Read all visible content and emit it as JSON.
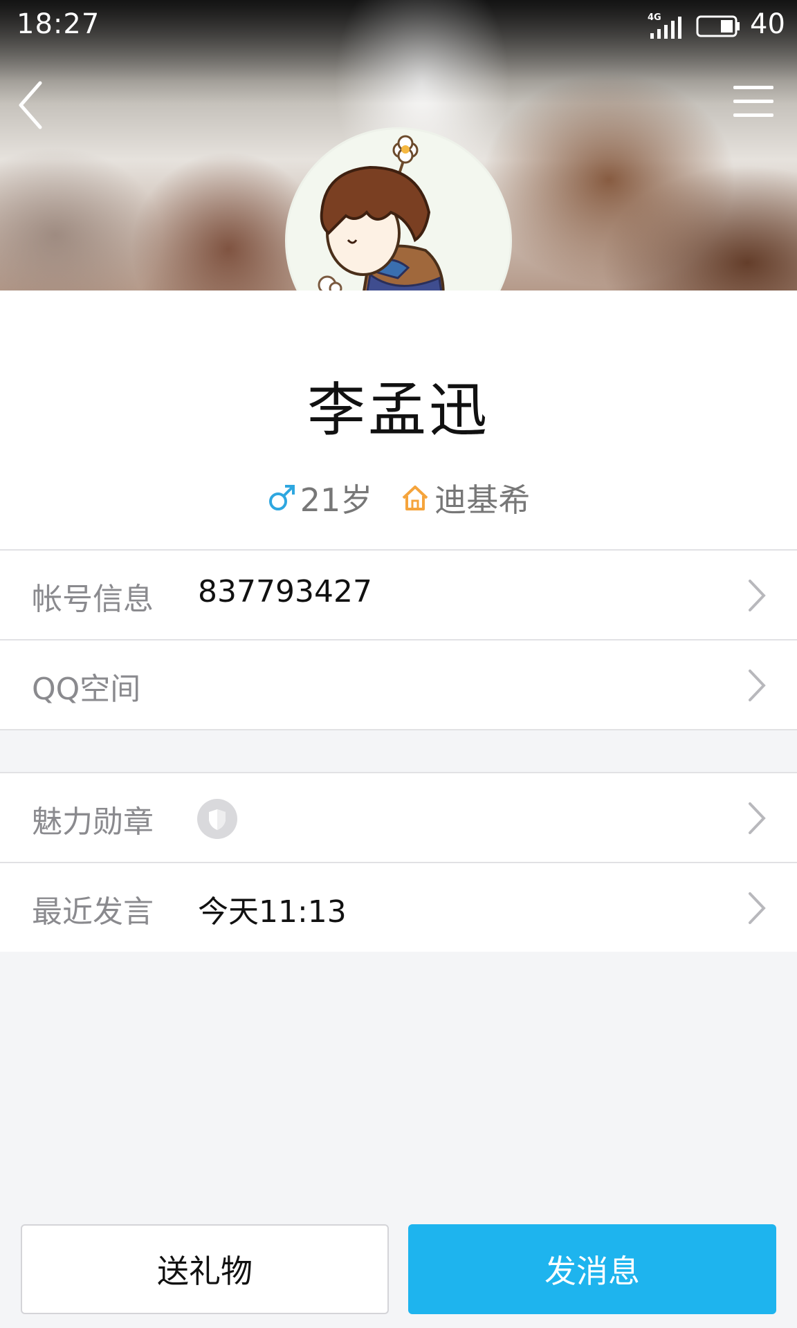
{
  "status_bar": {
    "time": "18:27",
    "network": "4G",
    "battery_level": "40"
  },
  "icons": {
    "back": "back-arrow-icon",
    "menu": "hamburger-menu-icon",
    "gender": "male-icon",
    "hometown": "home-icon",
    "chevron": "chevron-right-icon",
    "badge": "charm-badge-icon"
  },
  "colors": {
    "accent": "#1eb4ee",
    "male": "#2ea7e0",
    "home": "#f5a43c"
  },
  "profile": {
    "name": "李孟迅",
    "age": "21岁",
    "hometown": "迪基希"
  },
  "list": {
    "account": {
      "label": "帐号信息",
      "value": "837793427"
    },
    "qzone": {
      "label": "QQ空间"
    },
    "badge": {
      "label": "魅力勋章"
    },
    "recent_post": {
      "label": "最近发言",
      "value": "今天11:13"
    }
  },
  "actions": {
    "gift": "送礼物",
    "message": "发消息"
  }
}
